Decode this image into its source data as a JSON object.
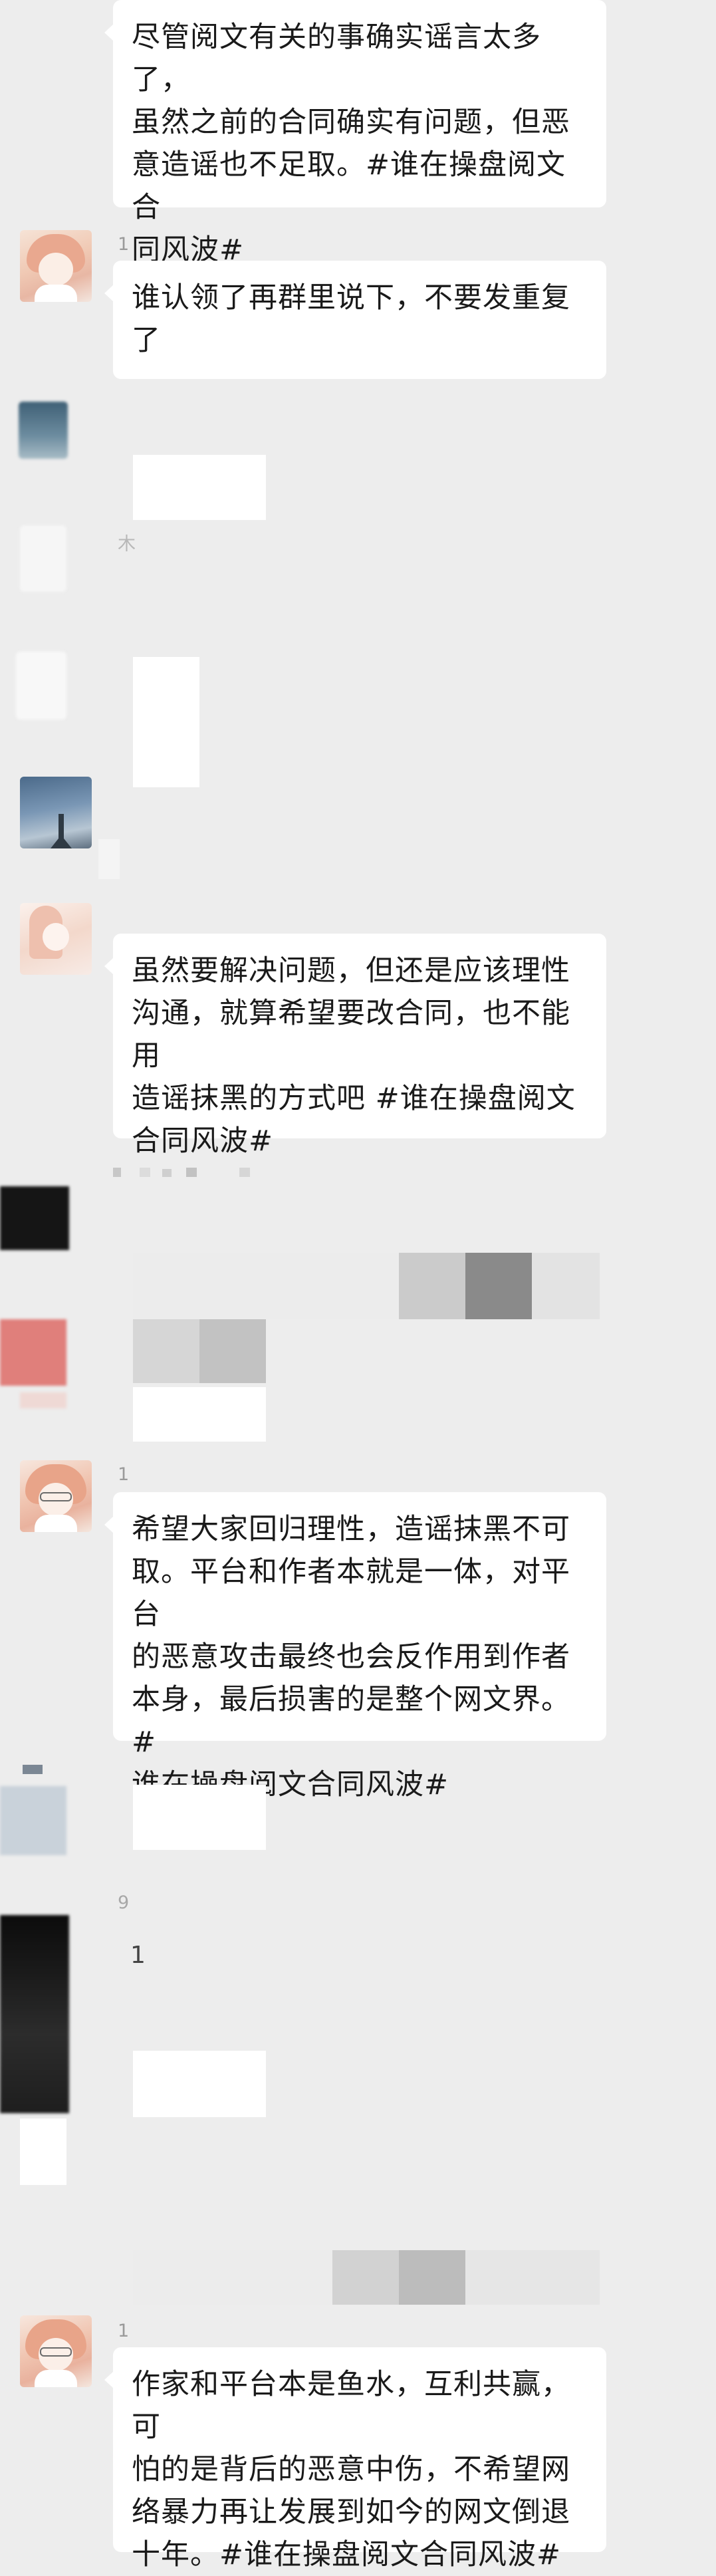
{
  "messages": [
    {
      "sender": "",
      "text": "尽管阅文有关的事确实谣言太多了，\n虽然之前的合同确实有问题，但恶\n意造谣也不足取。#谁在操盘阅文合\n同风波#"
    },
    {
      "sender": "1",
      "text": "谁认领了再群里说下，不要发重复\n了"
    },
    {
      "sender": "",
      "text": "虽然要解决问题，但还是应该理性\n沟通，就算希望要改合同，也不能用\n造谣抹黑的方式吧  #谁在操盘阅文\n合同风波#"
    },
    {
      "sender": "1",
      "text": "希望大家回归理性，造谣抹黑不可\n取。平台和作者本就是一体，对平台\n的恶意攻击最终也会反作用到作者\n本身，最后损害的是整个网文界。#\n谁在操盘阅文合同风波#"
    },
    {
      "sender": "1",
      "text": "作家和平台本是鱼水，互利共赢，可\n怕的是背后的恶意中伤，不希望网\n络暴力再让发展到如今的网文倒退\n十年。#谁在操盘阅文合同风波#"
    }
  ],
  "obscured": {
    "nick_a": "木",
    "nick_b": "9",
    "fragment_c": "1"
  }
}
